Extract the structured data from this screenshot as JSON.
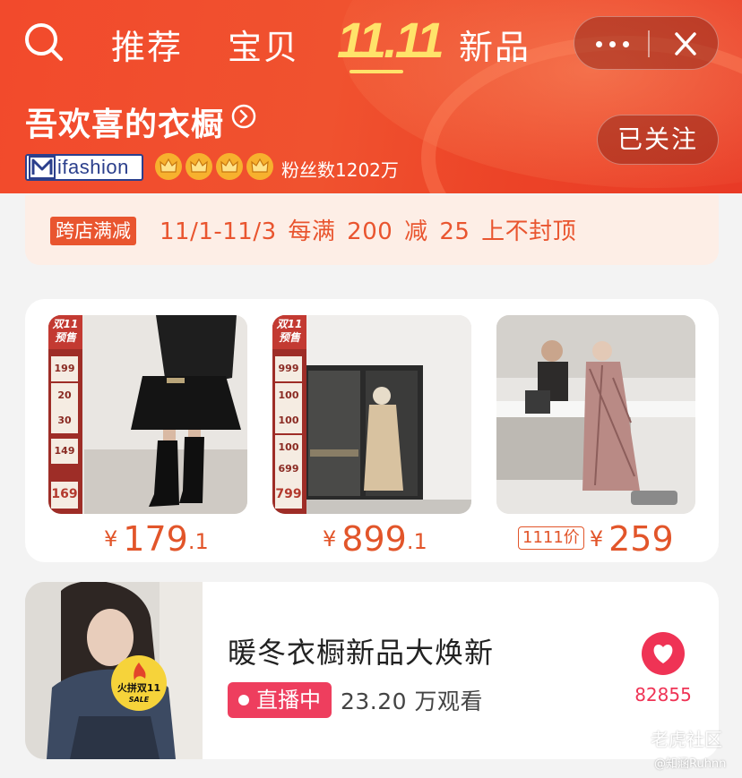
{
  "header": {
    "tabs": [
      "推荐",
      "宝贝",
      "新品"
    ],
    "festival_logo": "11.11",
    "shop_name": "吾欢喜的衣橱",
    "follow_label": "已关注",
    "brand_badge": "ifashion",
    "fans_text": "粉丝数1202万",
    "crown_count": 4,
    "icons": [
      "search-icon",
      "more-icon",
      "close-icon",
      "chevron-right-icon",
      "crown-icon"
    ]
  },
  "promo": {
    "tag": "跨店满减",
    "text": "11/1-11/3  每满 200 减 25  上不封顶"
  },
  "products": [
    {
      "currency": "¥",
      "price_main": "179",
      "price_dec": ".1",
      "sidebar": {
        "top": "双11\n预售",
        "values": [
          "199",
          "20",
          "30",
          "149",
          "169"
        ]
      }
    },
    {
      "currency": "¥",
      "price_main": "899",
      "price_dec": ".1",
      "sidebar": {
        "top": "双11\n预售",
        "values": [
          "999",
          "100",
          "100",
          "100",
          "699",
          "799"
        ]
      }
    },
    {
      "tag": "1111价",
      "currency": "¥",
      "price_main": "259",
      "price_dec": ""
    }
  ],
  "live": {
    "title": "暖冬衣橱新品大焕新",
    "badge": "直播中",
    "viewers": "23.20 万观看",
    "likes": "82855",
    "sticker_line1": "火拼双11",
    "sticker_line2": "SALE"
  },
  "watermark": {
    "main": "老虎社区",
    "sub": "@知涵Ruhnn"
  },
  "colors": {
    "header_red": "#f04a2c",
    "price_orange": "#e2552a",
    "live_pink": "#ee3e5e",
    "festival_yellow": "#ffe36a"
  }
}
